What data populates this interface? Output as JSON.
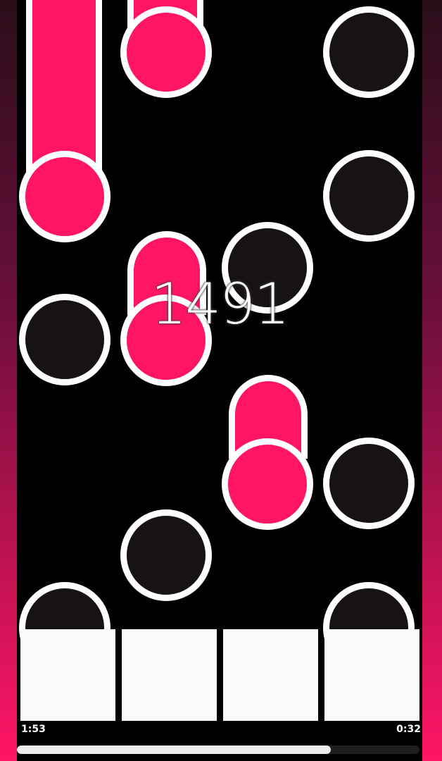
{
  "game": {
    "score": "1491",
    "time_elapsed": "1:53",
    "time_remaining": "0:32",
    "progress_fraction": 0.78
  },
  "colors": {
    "accent_pink": "#ff1466",
    "note_dark": "#171213",
    "outline": "#ffffff",
    "tap_zone": "#fafaf8"
  }
}
